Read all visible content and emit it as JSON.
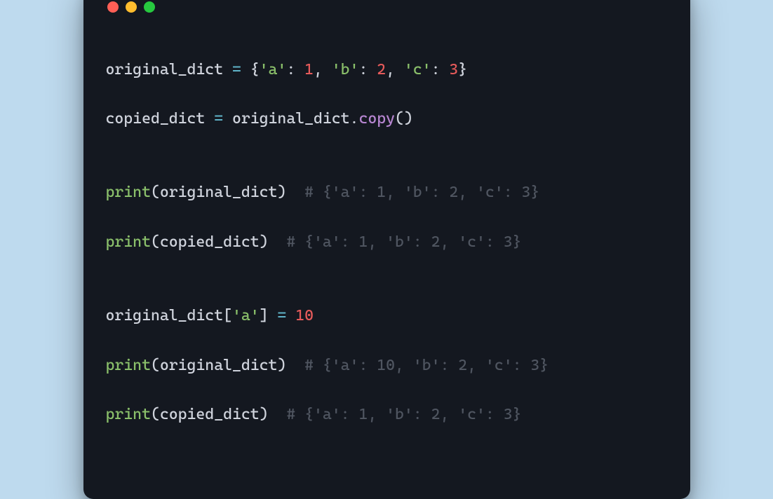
{
  "code": {
    "line1": {
      "ident1": "original_dict",
      "op_assign": " = ",
      "lbrace": "{",
      "str_a": "'a'",
      "colon1": ": ",
      "num1": "1",
      "comma1": ", ",
      "str_b": "'b'",
      "colon2": ": ",
      "num2": "2",
      "comma2": ", ",
      "str_c": "'c'",
      "colon3": ": ",
      "num3": "3",
      "rbrace": "}"
    },
    "line2": {
      "ident1": "copied_dict",
      "op_assign": " = ",
      "ident2": "original_dict",
      "dot": ".",
      "method": "copy",
      "parens": "()"
    },
    "line4": {
      "builtin": "print",
      "lparen": "(",
      "ident": "original_dict",
      "rparen": ")",
      "spacer": "  ",
      "comment": "# {'a': 1, 'b': 2, 'c': 3}"
    },
    "line5": {
      "builtin": "print",
      "lparen": "(",
      "ident": "copied_dict",
      "rparen": ")",
      "spacer": "  ",
      "comment": "# {'a': 1, 'b': 2, 'c': 3}"
    },
    "line7": {
      "ident": "original_dict",
      "lbracket": "[",
      "str_a": "'a'",
      "rbracket": "]",
      "op_assign": " = ",
      "num": "10"
    },
    "line8": {
      "builtin": "print",
      "lparen": "(",
      "ident": "original_dict",
      "rparen": ")",
      "spacer": "  ",
      "comment": "# {'a': 10, 'b': 2, 'c': 3}"
    },
    "line9": {
      "builtin": "print",
      "lparen": "(",
      "ident": "copied_dict",
      "rparen": ")",
      "spacer": "  ",
      "comment": "# {'a': 1, 'b': 2, 'c': 3}"
    }
  }
}
